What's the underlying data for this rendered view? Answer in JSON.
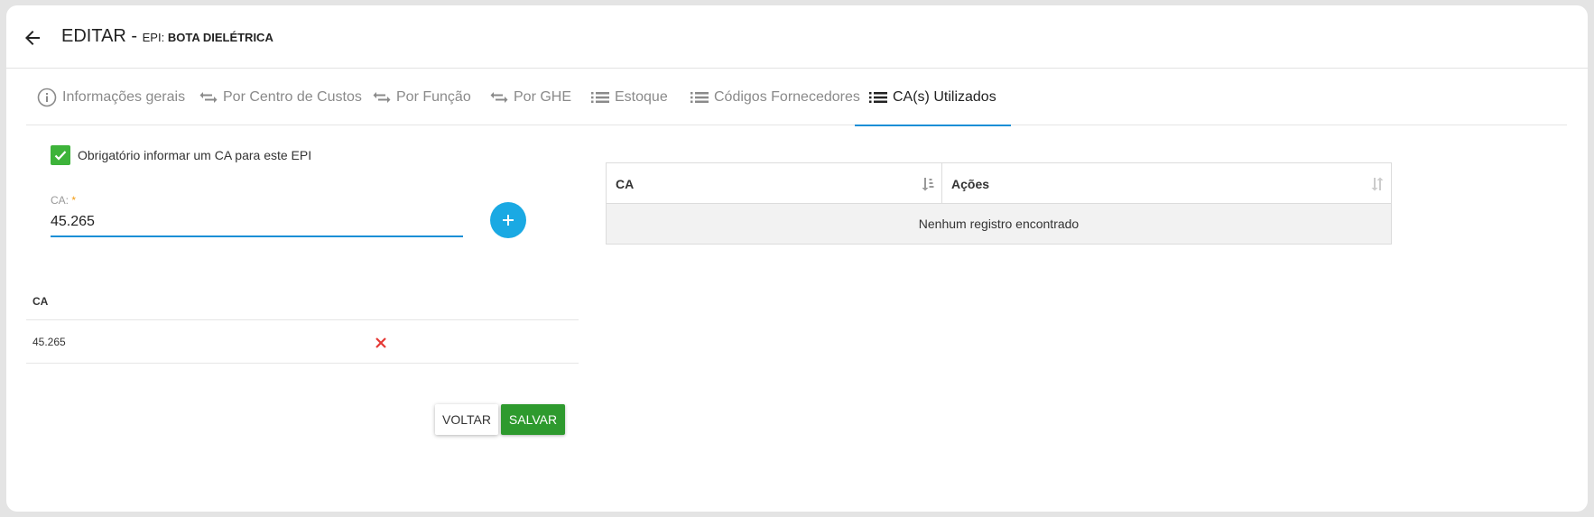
{
  "header": {
    "title": "EDITAR -",
    "subtitle_prefix": "EPI:",
    "subtitle_name": "BOTA DIELÉTRICA"
  },
  "tabs": [
    {
      "label": "Informações gerais",
      "icon": "info-icon",
      "active": false
    },
    {
      "label": "Por Centro de Custos",
      "icon": "swap-icon",
      "active": false
    },
    {
      "label": "Por Função",
      "icon": "swap-icon",
      "active": false
    },
    {
      "label": "Por GHE",
      "icon": "swap-icon",
      "active": false
    },
    {
      "label": "Estoque",
      "icon": "list-icon",
      "active": false
    },
    {
      "label": "Códigos Fornecedores",
      "icon": "list-icon",
      "active": false
    },
    {
      "label": "CA(s) Utilizados",
      "icon": "list-icon",
      "active": true
    }
  ],
  "form": {
    "checkbox_label": "Obrigatório informar um CA para este EPI",
    "checkbox_checked": true,
    "ca_label": "CA:",
    "ca_required_mark": "*",
    "ca_value": "45.265"
  },
  "ca_list": {
    "header": "CA",
    "rows": [
      {
        "value": "45.265"
      }
    ]
  },
  "buttons": {
    "voltar": "VOLTAR",
    "salvar": "SALVAR"
  },
  "right_table": {
    "columns": [
      "CA",
      "Ações"
    ],
    "empty_message": "Nenhum registro encontrado"
  },
  "colors": {
    "accent": "#1a8fd6",
    "add_button": "#1aa9e3",
    "save_button": "#2e9a2e",
    "checkbox": "#3db33a",
    "delete": "#e53935"
  }
}
